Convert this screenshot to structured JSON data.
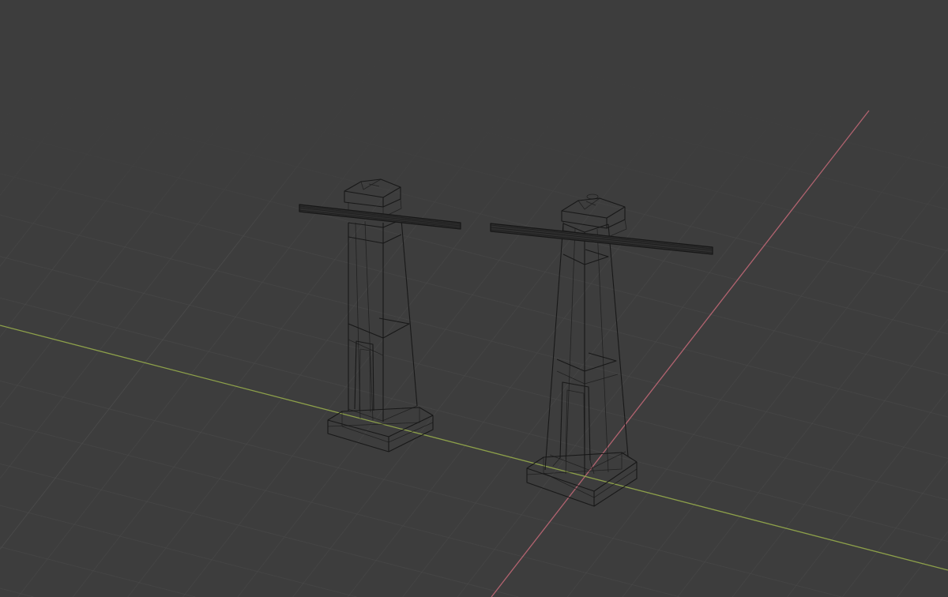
{
  "viewport": {
    "background_color": "#3d3d3d",
    "grid_line_color": "#4a4a4a",
    "x_axis_color": "#b26370",
    "y_axis_color": "#8da04a",
    "wire_color": "#161616",
    "view_mode": "wireframe"
  },
  "scene_objects": [
    {
      "name": "post-left",
      "type": "mesh"
    },
    {
      "name": "post-right",
      "type": "mesh"
    }
  ]
}
